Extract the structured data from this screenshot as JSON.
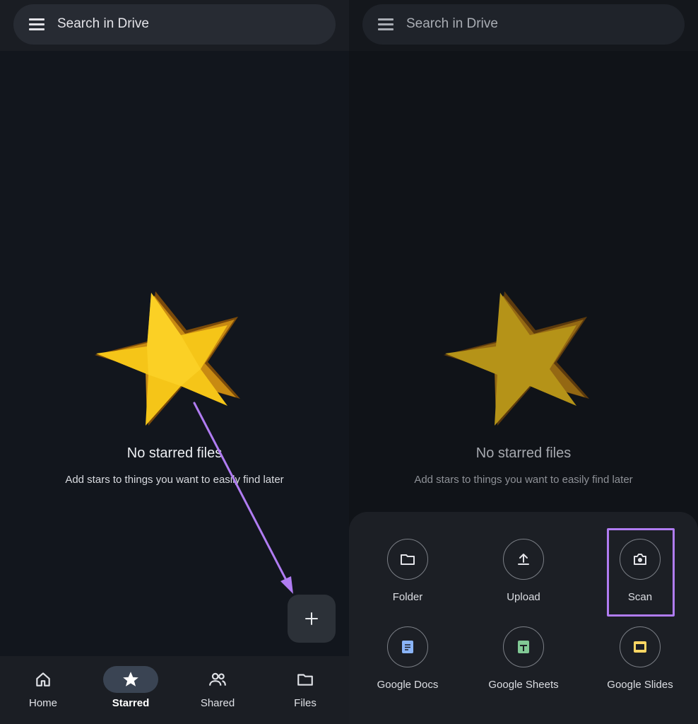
{
  "search": {
    "placeholder": "Search in Drive"
  },
  "empty_state": {
    "title": "No starred files",
    "subtitle": "Add stars to things you want to easily find later"
  },
  "bottom_nav": {
    "items": [
      {
        "label": "Home",
        "icon": "home-icon",
        "active": false
      },
      {
        "label": "Starred",
        "icon": "star-icon",
        "active": true
      },
      {
        "label": "Shared",
        "icon": "people-icon",
        "active": false
      },
      {
        "label": "Files",
        "icon": "folder-icon",
        "active": false
      }
    ]
  },
  "create_sheet": {
    "options": [
      {
        "label": "Folder",
        "icon": "folder-icon"
      },
      {
        "label": "Upload",
        "icon": "upload-icon"
      },
      {
        "label": "Scan",
        "icon": "camera-icon"
      },
      {
        "label": "Google Docs",
        "icon": "docs-icon"
      },
      {
        "label": "Google Sheets",
        "icon": "sheets-icon"
      },
      {
        "label": "Google Slides",
        "icon": "slides-icon"
      }
    ]
  },
  "colors": {
    "annotation": "#b07cf2",
    "star": "#f5c518",
    "docs": "#8ab4f8",
    "sheets": "#81c995",
    "slides": "#fdd663"
  }
}
